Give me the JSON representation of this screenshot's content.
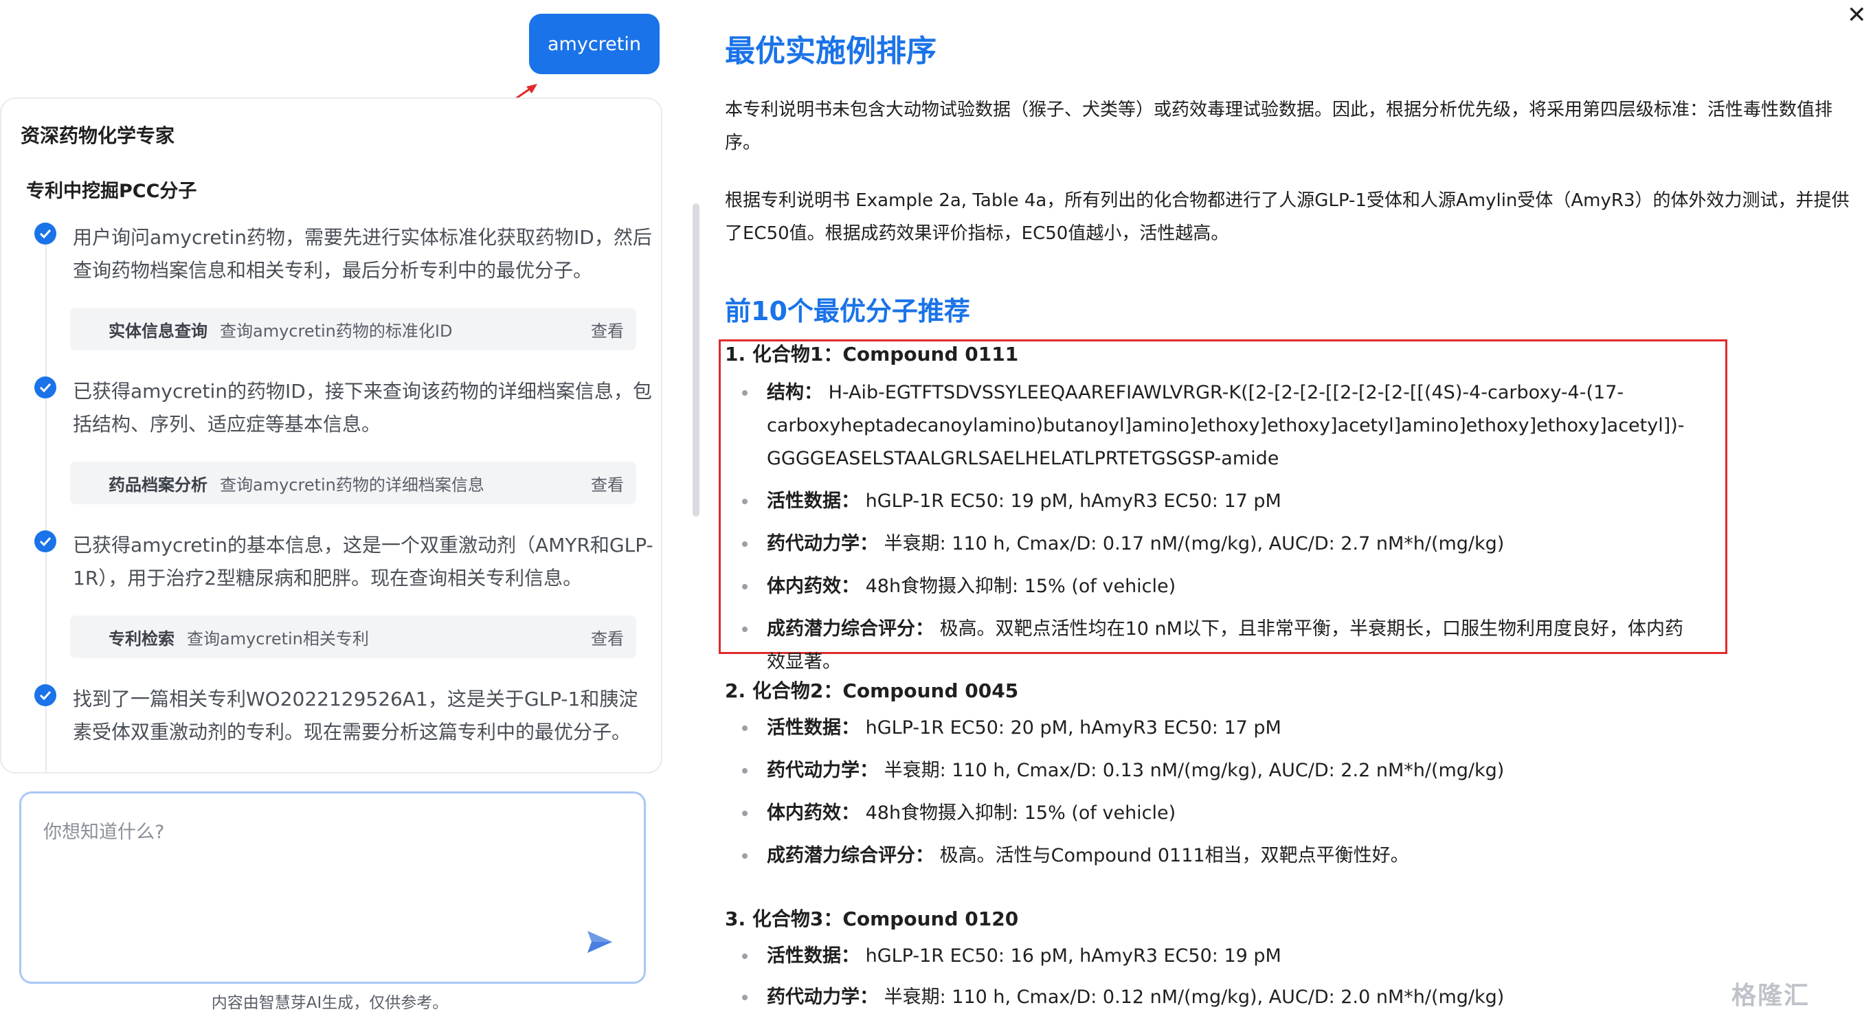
{
  "chat": {
    "user_message": "amycretin",
    "card_title": "资深药物化学专家",
    "card_subtitle": "专利中挖掘PCC分子",
    "steps": [
      {
        "text": "用户询问amycretin药物，需要先进行实体标准化获取药物ID，然后查询药物档案信息和相关专利，最后分析专利中的最优分子。",
        "tool": {
          "name": "实体信息查询",
          "desc": "查询amycretin药物的标准化ID",
          "view": "查看"
        }
      },
      {
        "text": "已获得amycretin的药物ID，接下来查询该药物的详细档案信息，包括结构、序列、适应症等基本信息。",
        "tool": {
          "name": "药品档案分析",
          "desc": "查询amycretin药物的详细档案信息",
          "view": "查看"
        }
      },
      {
        "text": "已获得amycretin的基本信息，这是一个双重激动剂（AMYR和GLP-1R），用于治疗2型糖尿病和肥胖。现在查询相关专利信息。",
        "tool": {
          "name": "专利检索",
          "desc": "查询amycretin相关专利",
          "view": "查看"
        }
      },
      {
        "text": "找到了一篇相关专利WO2022129526A1，这是关于GLP-1和胰淀素受体双重激动剂的专利。现在需要分析这篇专利中的最优分子。"
      }
    ],
    "input_placeholder": "你想知道什么?",
    "disclaimer": "内容由智慧芽AI生成，仅供参考。"
  },
  "report": {
    "title": "最优实施例排序",
    "para1": "本专利说明书未包含大动物试验数据（猴子、犬类等）或药效毒理试验数据。因此，根据分析优先级，将采用第四层级标准：活性毒性数值排序。",
    "para2": "根据专利说明书 Example 2a, Table 4a，所有列出的化合物都进行了人源GLP-1受体和人源Amylin受体（AmyR3）的体外效力测试，并提供了EC50值。根据成药效果评价指标，EC50值越小，活性越高。",
    "subtitle": "前10个最优分子推荐",
    "compounds": [
      {
        "title": "1. 化合物1：Compound 0111",
        "items": [
          {
            "label": "结构：",
            "value": "H-Aib-EGTFTSDVSSYLEEQAAREFIAWLVRGR-K([2-[2-[2-[[2-[2-[2-[[(4S)-4-carboxy-4-(17-carboxyheptadecanoylamino)butanoyl]amino]ethoxy]ethoxy]acetyl]amino]ethoxy]ethoxy]acetyl])-GGGGEASELSTAALGRLSAELHELATLPRTETGSGSP-amide"
          },
          {
            "label": "活性数据：",
            "value": "hGLP-1R EC50: 19 pM, hAmyR3 EC50: 17 pM"
          },
          {
            "label": "药代动力学：",
            "value": "半衰期: 110 h, Cmax/D: 0.17 nM/(mg/kg), AUC/D: 2.7 nM*h/(mg/kg)"
          },
          {
            "label": "体内药效：",
            "value": "48h食物摄入抑制: 15% (of vehicle)"
          },
          {
            "label": "成药潜力综合评分：",
            "value": "极高。双靶点活性均在10 nM以下，且非常平衡，半衰期长，口服生物利用度良好，体内药效显著。"
          }
        ]
      },
      {
        "title": "2. 化合物2：Compound 0045",
        "items": [
          {
            "label": "活性数据：",
            "value": "hGLP-1R EC50: 20 pM, hAmyR3 EC50: 17 pM"
          },
          {
            "label": "药代动力学：",
            "value": "半衰期: 110 h, Cmax/D: 0.13 nM/(mg/kg), AUC/D: 2.2 nM*h/(mg/kg)"
          },
          {
            "label": "体内药效：",
            "value": "48h食物摄入抑制: 15% (of vehicle)"
          },
          {
            "label": "成药潜力综合评分：",
            "value": "极高。活性与Compound 0111相当，双靶点平衡性好。"
          }
        ]
      },
      {
        "title": "3. 化合物3：Compound 0120",
        "items": [
          {
            "label": "活性数据：",
            "value": "hGLP-1R EC50: 16 pM, hAmyR3 EC50: 19 pM"
          },
          {
            "label": "药代动力学：",
            "value": "半衰期: 110 h, Cmax/D: 0.12 nM/(mg/kg), AUC/D: 2.0 nM*h/(mg/kg)"
          }
        ]
      }
    ]
  },
  "watermark": "格隆汇",
  "colors": {
    "accent": "#1a73e8",
    "highlight": "#e02a2a"
  }
}
